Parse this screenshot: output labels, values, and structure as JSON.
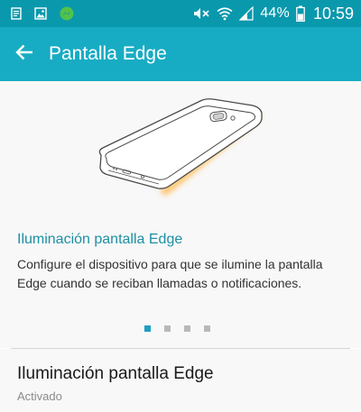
{
  "status_bar": {
    "battery_percent": "44%",
    "time": "10:59",
    "left_icons": [
      "notes-icon",
      "gallery-icon",
      "messenger-icon"
    ],
    "right_icons": [
      "mute-icon",
      "wifi-icon",
      "signal-icon",
      "battery-icon"
    ]
  },
  "app_bar": {
    "title": "Pantalla Edge",
    "back_icon": "back-arrow-icon",
    "color": "#18acc4"
  },
  "intro": {
    "title": "Iluminación pantalla Edge",
    "description": "Configure el dispositivo para que se ilumine la pantalla Edge cuando se reciban llamadas o notificaciones.",
    "pages_total": 4,
    "active_page": 1,
    "accent_color": "#1d8fa3"
  },
  "setting": {
    "title": "Iluminación pantalla Edge",
    "summary": "Activado"
  }
}
